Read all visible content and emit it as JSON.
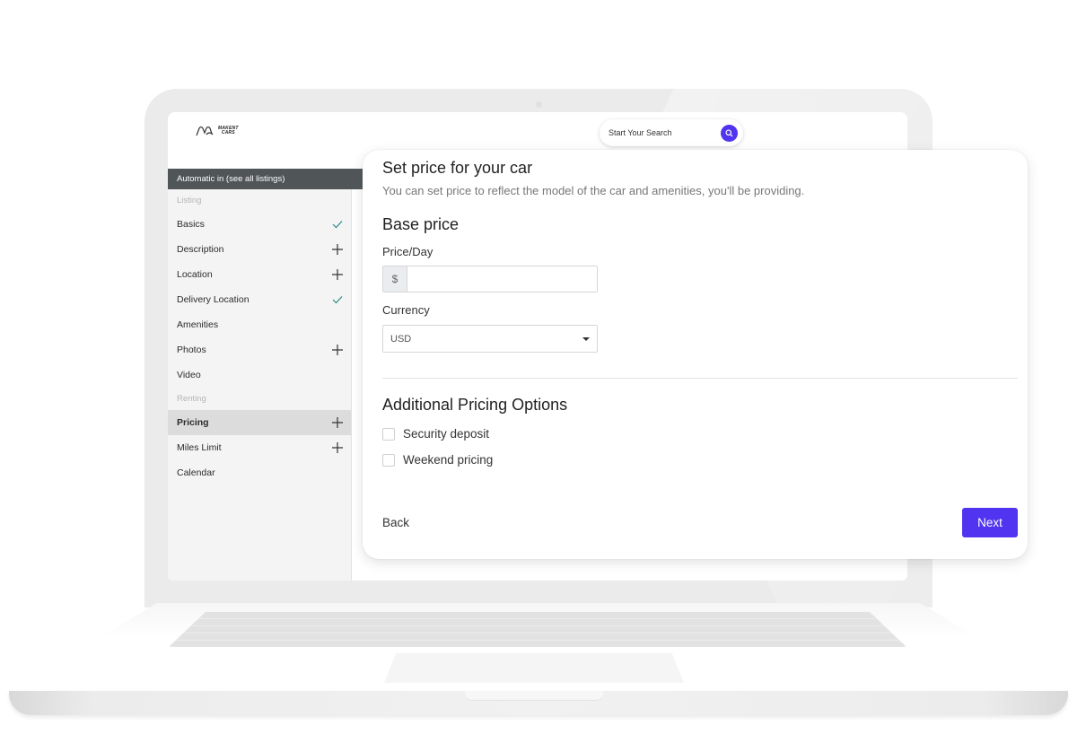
{
  "header": {
    "logo_line1": "MAKENT",
    "logo_line2": "CARS",
    "search_placeholder": "Start Your Search",
    "search_icon": "search-icon"
  },
  "sidebar": {
    "header": "Automatic in  (see all listings)",
    "sections": [
      {
        "title": "Listing",
        "items": [
          {
            "label": "Basics",
            "status": "done",
            "icon": "check-icon"
          },
          {
            "label": "Description",
            "status": "todo",
            "icon": "plus-icon"
          },
          {
            "label": "Location",
            "status": "todo",
            "icon": "plus-icon"
          },
          {
            "label": "Delivery Location",
            "status": "done",
            "icon": "check-icon"
          },
          {
            "label": "Amenities",
            "status": "none",
            "icon": ""
          },
          {
            "label": "Photos",
            "status": "todo",
            "icon": "plus-icon"
          },
          {
            "label": "Video",
            "status": "none",
            "icon": ""
          }
        ]
      },
      {
        "title": "Renting",
        "items": [
          {
            "label": "Pricing",
            "status": "todo",
            "icon": "plus-icon",
            "active": true
          },
          {
            "label": "Miles Limit",
            "status": "todo",
            "icon": "plus-icon"
          },
          {
            "label": "Calendar",
            "status": "none",
            "icon": ""
          }
        ]
      }
    ]
  },
  "card": {
    "title": "Set price for your car",
    "subtitle": "You can set price to reflect the model of the car and amenities, you'll be providing.",
    "base_price": {
      "title": "Base price",
      "price_label": "Price/Day",
      "currency_symbol": "$",
      "price_value": "",
      "currency_label": "Currency",
      "currency_selected": "USD"
    },
    "additional": {
      "title": "Additional Pricing Options",
      "options": [
        {
          "label": "Security deposit",
          "checked": false
        },
        {
          "label": "Weekend pricing",
          "checked": false
        }
      ]
    },
    "back_label": "Back",
    "next_label": "Next"
  },
  "colors": {
    "accent": "#5034f0",
    "check": "#2a8a8a",
    "sidebar_header": "#505558"
  }
}
